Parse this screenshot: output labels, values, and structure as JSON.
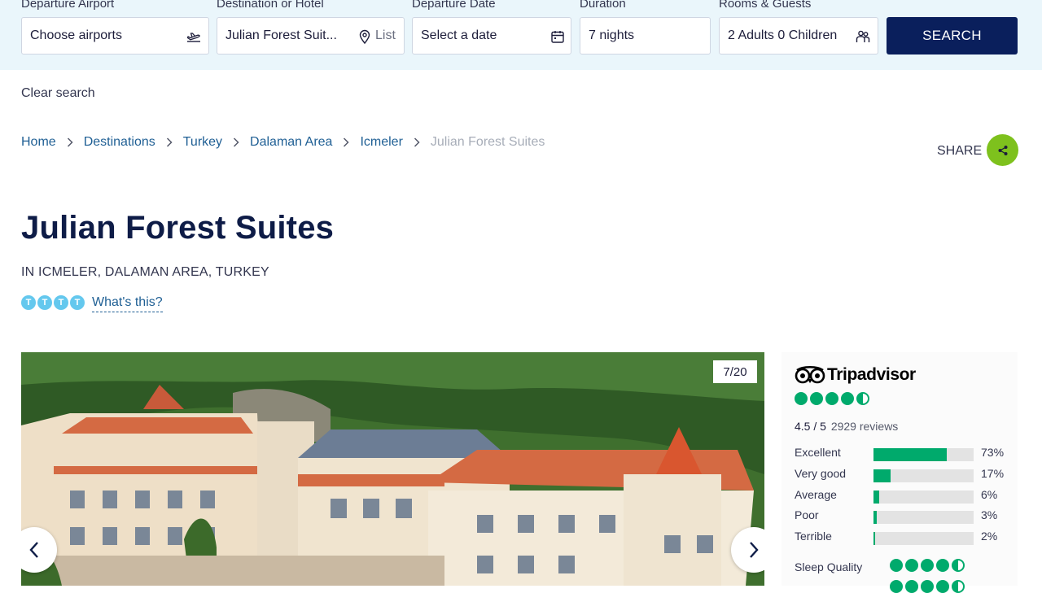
{
  "search": {
    "departure": {
      "label": "Departure Airport",
      "value": "Choose airports",
      "icon": "plane-departure-icon"
    },
    "destination": {
      "label": "Destination or Hotel",
      "value": "Julian Forest Suit...",
      "list_label": "List",
      "icon": "map-pin-icon"
    },
    "date": {
      "label": "Departure Date",
      "value": "Select a date",
      "icon": "calendar-icon"
    },
    "duration": {
      "label": "Duration",
      "value": "7 nights"
    },
    "guests": {
      "label": "Rooms & Guests",
      "value": "2 Adults 0 Children",
      "icon": "guests-icon"
    },
    "button": "SEARCH",
    "clear": "Clear search"
  },
  "breadcrumb": [
    {
      "label": "Home"
    },
    {
      "label": "Destinations"
    },
    {
      "label": "Turkey"
    },
    {
      "label": "Dalaman Area"
    },
    {
      "label": "Icmeler"
    },
    {
      "label": "Julian Forest Suites",
      "current": true
    }
  ],
  "share": {
    "label": "SHARE",
    "icon": "share-icon",
    "color": "#7ec11d"
  },
  "hotel": {
    "name": "Julian Forest Suites",
    "location": "IN ICMELER, DALAMAN AREA, TURKEY",
    "t_rating": {
      "letter": "T",
      "count": 4
    },
    "whats_this": "What's this?"
  },
  "gallery": {
    "counter": "7/20",
    "prev_icon": "chevron-left-icon",
    "next_icon": "chevron-right-icon"
  },
  "tripadvisor": {
    "brand": "Tripadvisor",
    "accent": "#00aa6c",
    "bubble_rating": 4.5,
    "score": "4.5 / 5",
    "reviews": "2929 reviews",
    "breakdown": [
      {
        "label": "Excellent",
        "pct": "73%",
        "value": 73
      },
      {
        "label": "Very good",
        "pct": "17%",
        "value": 17
      },
      {
        "label": "Average",
        "pct": "6%",
        "value": 6
      },
      {
        "label": "Poor",
        "pct": "3%",
        "value": 3
      },
      {
        "label": "Terrible",
        "pct": "2%",
        "value": 2
      }
    ],
    "sub_ratings": [
      {
        "label": "Sleep Quality",
        "value": 4.5
      }
    ]
  },
  "colors": {
    "navy": "#0a1f5c",
    "link": "#1f5f94",
    "searchbar_bg": "#eaf6fb",
    "t_blue": "#64c8ee"
  }
}
